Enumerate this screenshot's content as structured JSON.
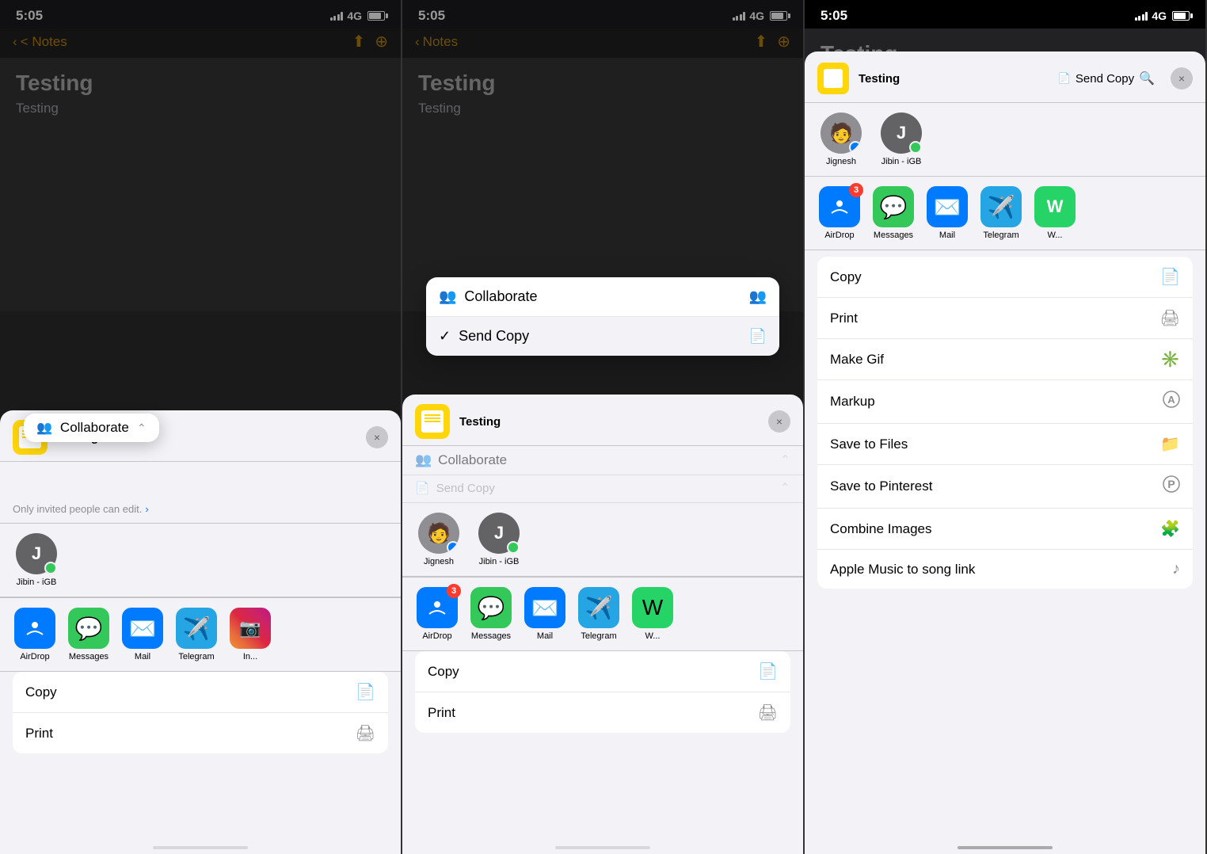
{
  "panel1": {
    "status": {
      "time": "5:05",
      "signal": "4G",
      "battery": "75"
    },
    "nav": {
      "back_label": "< Notes",
      "share_icon": "⬆",
      "more_icon": "⊕"
    },
    "note": {
      "title": "Testing",
      "body": "Testing"
    },
    "share_header": {
      "note_title": "Testing",
      "close": "×"
    },
    "collab_popup": {
      "label": "Collaborate",
      "chevron": "⌃"
    },
    "collab_desc": "Only invited people can edit.",
    "contacts": [
      {
        "name": "Jibin - iGB",
        "initial": "J",
        "color": "#636366",
        "badge": "messages"
      }
    ],
    "apps": [
      {
        "name": "AirDrop",
        "type": "airdrop"
      },
      {
        "name": "Messages",
        "type": "messages"
      },
      {
        "name": "Mail",
        "type": "mail"
      },
      {
        "name": "Telegram",
        "type": "telegram"
      },
      {
        "name": "In...",
        "type": "instagram"
      }
    ],
    "actions": [
      {
        "label": "Copy",
        "icon": "📄"
      },
      {
        "label": "Print",
        "icon": "🖨"
      }
    ]
  },
  "panel2": {
    "status": {
      "time": "5:05",
      "signal": "4G"
    },
    "nav": {
      "back_label": "< Notes"
    },
    "note": {
      "title": "Testing",
      "body": "Testing"
    },
    "share_header": {
      "note_title": "Testing",
      "close": "×"
    },
    "dropdown": {
      "option1": "Collaborate",
      "option2": "Send Copy",
      "option2_checked": true,
      "option1_icon": "👥",
      "option2_icon": "📄"
    },
    "collab_row": {
      "label": "Collaborate",
      "icon": "👥"
    },
    "send_copy_row": {
      "label": "Send Copy",
      "icon": "📄"
    },
    "contacts": [
      {
        "name": "Jignesh",
        "type": "photo",
        "badge": "airdrop"
      },
      {
        "name": "Jibin - iGB",
        "initial": "J",
        "color": "#636366",
        "badge": "messages"
      }
    ],
    "apps": [
      {
        "name": "AirDrop",
        "type": "airdrop",
        "badge": "3"
      },
      {
        "name": "Messages",
        "type": "messages"
      },
      {
        "name": "Mail",
        "type": "mail"
      },
      {
        "name": "Telegram",
        "type": "telegram"
      },
      {
        "name": "W...",
        "type": "extra"
      }
    ],
    "actions": [
      {
        "label": "Copy",
        "icon": "📄"
      },
      {
        "label": "Print",
        "icon": "🖨"
      }
    ]
  },
  "panel3": {
    "status": {
      "time": "5:05",
      "signal": "4G"
    },
    "header": {
      "title": "Testing",
      "send_copy_label": "Send Copy",
      "close": "×",
      "search_icon": "🔍"
    },
    "contacts": [
      {
        "name": "Jignesh",
        "type": "photo",
        "badge": "airdrop"
      },
      {
        "name": "Jibin - iGB",
        "initial": "J",
        "color": "#636366",
        "badge": "messages"
      }
    ],
    "apps": [
      {
        "name": "AirDrop",
        "type": "airdrop",
        "badge": "3"
      },
      {
        "name": "Messages",
        "type": "messages"
      },
      {
        "name": "Mail",
        "type": "mail"
      },
      {
        "name": "Telegram",
        "type": "telegram"
      }
    ],
    "actions": [
      {
        "label": "Copy",
        "icon": "📄",
        "highlighted": false
      },
      {
        "label": "Print",
        "icon": "🖨",
        "highlighted": false
      },
      {
        "label": "Make Gif",
        "icon": "✳",
        "highlighted": false
      },
      {
        "label": "Markup",
        "icon": "Ⓐ",
        "highlighted": true
      },
      {
        "label": "Save to Files",
        "icon": "📁",
        "highlighted": false
      },
      {
        "label": "Save to Pinterest",
        "icon": "𝐏",
        "highlighted": false
      },
      {
        "label": "Combine Images",
        "icon": "🧩",
        "highlighted": false
      },
      {
        "label": "Apple Music to song link",
        "icon": "♪",
        "highlighted": false
      }
    ]
  }
}
